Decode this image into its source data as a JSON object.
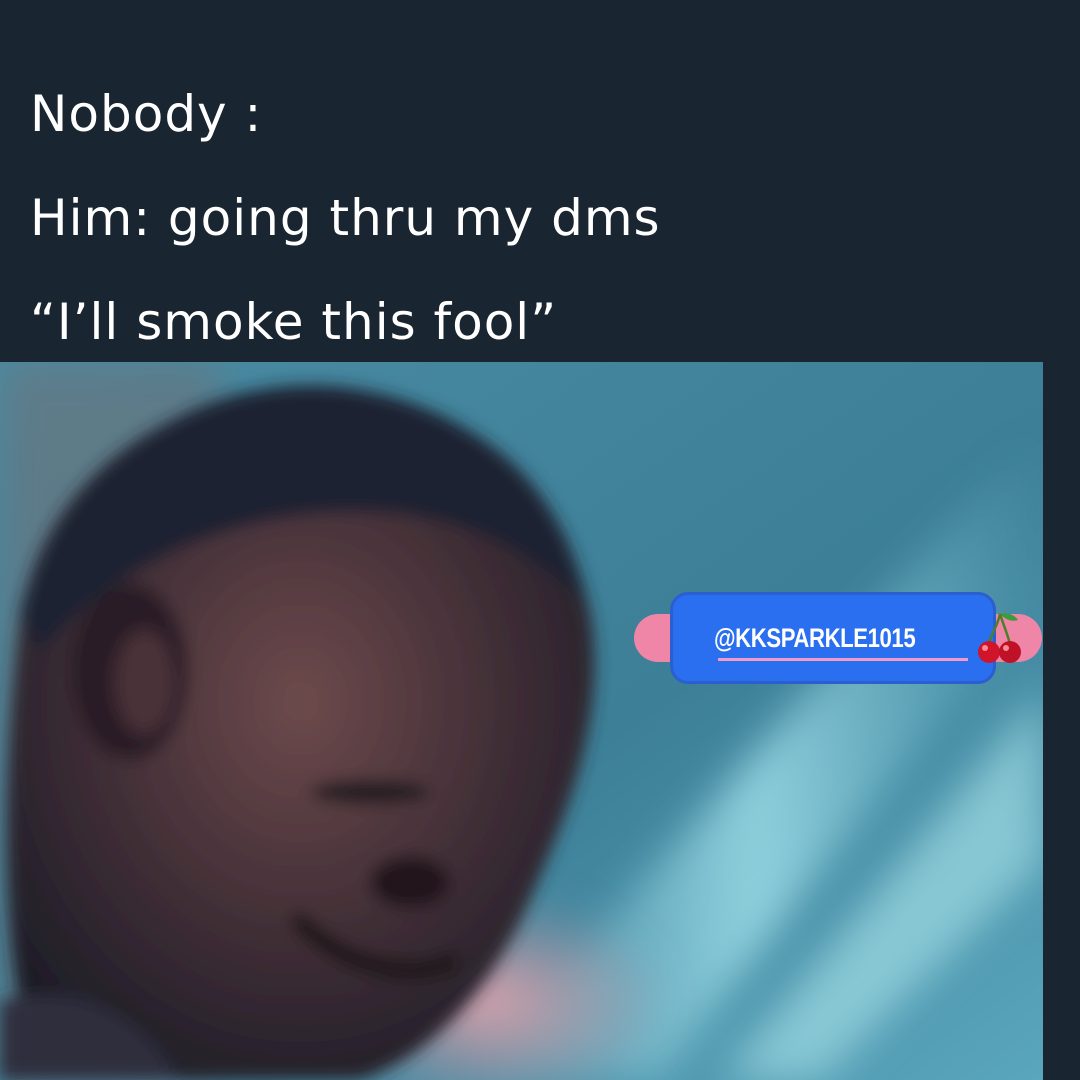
{
  "caption": {
    "line1": "Nobody :",
    "line2": "Him: going thru my dms",
    "line3": "“I’ll smoke this fool”"
  },
  "photo": {
    "icon": "man-laughing-photo"
  },
  "watermark": {
    "handle": "@KKSPARKLE1015",
    "icon": "cherry-icon",
    "bubble_color": "#2a6ff0",
    "highlight_color": "#ef86a8"
  },
  "colors": {
    "background": "#192530",
    "caption_text": "#ffffff"
  }
}
